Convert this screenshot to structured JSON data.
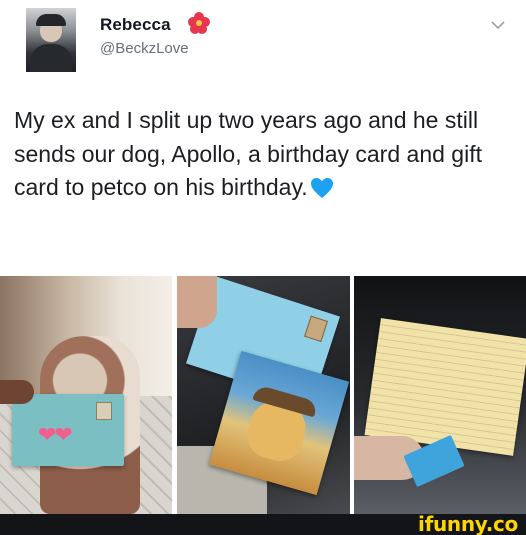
{
  "tweet": {
    "display_name": "Rebecca",
    "name_emoji_icon": "hibiscus-flower-icon",
    "handle": "@BeckzLove",
    "text": "My ex and I split up two years ago and he still sends our dog, Apollo, a birthday card and gift card to petco on his birthday.",
    "text_end_icon": "blue-heart-icon"
  },
  "media": {
    "photos": [
      {
        "name": "dog-holding-envelope-photo"
      },
      {
        "name": "envelope-and-dog-card-photo"
      },
      {
        "name": "open-card-with-gift-card-photo"
      }
    ]
  },
  "watermark": "ifunny.co",
  "colors": {
    "background": "#ffffff",
    "text": "#1c1e21",
    "handle": "#66707a",
    "heart": "#1da1f2",
    "flower": "#e8364f",
    "watermark": "#ffd500",
    "footer": "#121417"
  }
}
